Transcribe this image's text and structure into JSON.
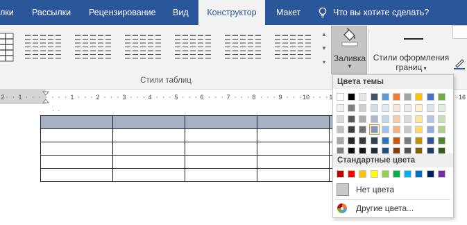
{
  "tabs": {
    "items": [
      {
        "label": "лки"
      },
      {
        "label": "Рассылки"
      },
      {
        "label": "Рецензирование"
      },
      {
        "label": "Вид"
      },
      {
        "label": "Конструктор"
      },
      {
        "label": "Макет"
      }
    ],
    "active": "Конструктор",
    "tell_me": "Что вы хотите сделать?"
  },
  "ribbon": {
    "table_styles_label": "Стили таблиц",
    "shading_button": "Заливка",
    "border_styles_button_line1": "Стили оформления",
    "border_styles_button_line2": "границ"
  },
  "ruler": {
    "numbers": [
      "1",
      "2",
      "1",
      "2",
      "3",
      "4",
      "5",
      "6",
      "7",
      "8",
      "9",
      "10",
      "11",
      "12",
      "13",
      "14",
      "15",
      "16"
    ]
  },
  "shading_dropdown": {
    "theme_colors_header": "Цвета темы",
    "standard_colors_header": "Стандартные цвета",
    "no_color": "Нет цвета",
    "more_colors": "Другие цвета...",
    "theme_colors": [
      [
        "#ffffff",
        "#f2f2f2",
        "#d9d9d9",
        "#bfbfbf",
        "#a6a6a6",
        "#808080"
      ],
      [
        "#000000",
        "#7f7f7f",
        "#595959",
        "#404040",
        "#262626",
        "#0d0d0d"
      ],
      [
        "#e7e6e6",
        "#d0cece",
        "#aeaaaa",
        "#757171",
        "#3b3838",
        "#171616"
      ],
      [
        "#44546a",
        "#d6dce5",
        "#adb9ca",
        "#8497b0",
        "#333f50",
        "#222a35"
      ],
      [
        "#5b9bd5",
        "#deebf7",
        "#bdd7ee",
        "#9dc3e6",
        "#2e75b6",
        "#1f4e79"
      ],
      [
        "#ed7d31",
        "#fbe5d6",
        "#f8cbad",
        "#f4b183",
        "#c55a11",
        "#843c0c"
      ],
      [
        "#a5a5a5",
        "#ededed",
        "#dbdbdb",
        "#c9c9c9",
        "#7b7b7b",
        "#525252"
      ],
      [
        "#ffc000",
        "#fff2cc",
        "#ffe699",
        "#ffd966",
        "#bf9000",
        "#7f6000"
      ],
      [
        "#4472c4",
        "#dae3f3",
        "#b4c7e7",
        "#8faadc",
        "#2f5597",
        "#203864"
      ],
      [
        "#70ad47",
        "#e2f0d9",
        "#c5e0b4",
        "#a9d18e",
        "#548235",
        "#385723"
      ]
    ],
    "standard_colors": [
      "#c00000",
      "#ff0000",
      "#ffc000",
      "#ffff00",
      "#92d050",
      "#00b050",
      "#00b0f0",
      "#0070c0",
      "#002060",
      "#7030a0"
    ],
    "selected_color": "#8497b0",
    "accent": "#2b579a"
  },
  "document": {
    "table_header_color": "#a6b2c4"
  }
}
